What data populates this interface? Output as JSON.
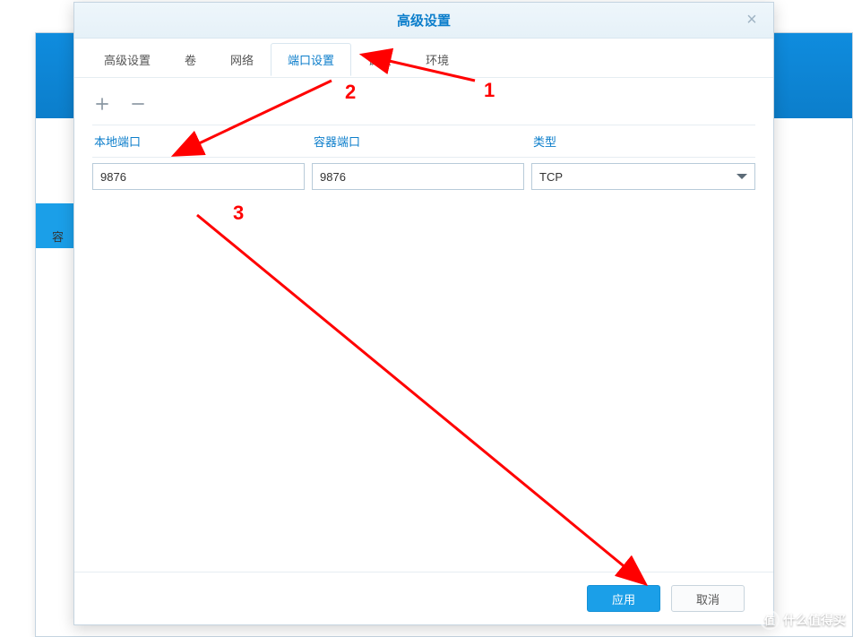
{
  "dialog": {
    "title": "高级设置",
    "close_label": "×"
  },
  "tabs": [
    {
      "label": "高级设置",
      "active": false
    },
    {
      "label": "卷",
      "active": false
    },
    {
      "label": "网络",
      "active": false
    },
    {
      "label": "端口设置",
      "active": true
    },
    {
      "label": "链接",
      "active": false
    },
    {
      "label": "环境",
      "active": false
    }
  ],
  "columns": {
    "local_port": "本地端口",
    "container_port": "容器端口",
    "type": "类型"
  },
  "rows": [
    {
      "local_port": "9876",
      "container_port": "9876",
      "type": "TCP"
    }
  ],
  "footer": {
    "apply": "应用",
    "cancel": "取消"
  },
  "background": {
    "sidebar_char": "容"
  },
  "annotations": {
    "n1": "1",
    "n2": "2",
    "n3": "3"
  },
  "watermark": {
    "text": "什么值得买",
    "badge": "值"
  }
}
